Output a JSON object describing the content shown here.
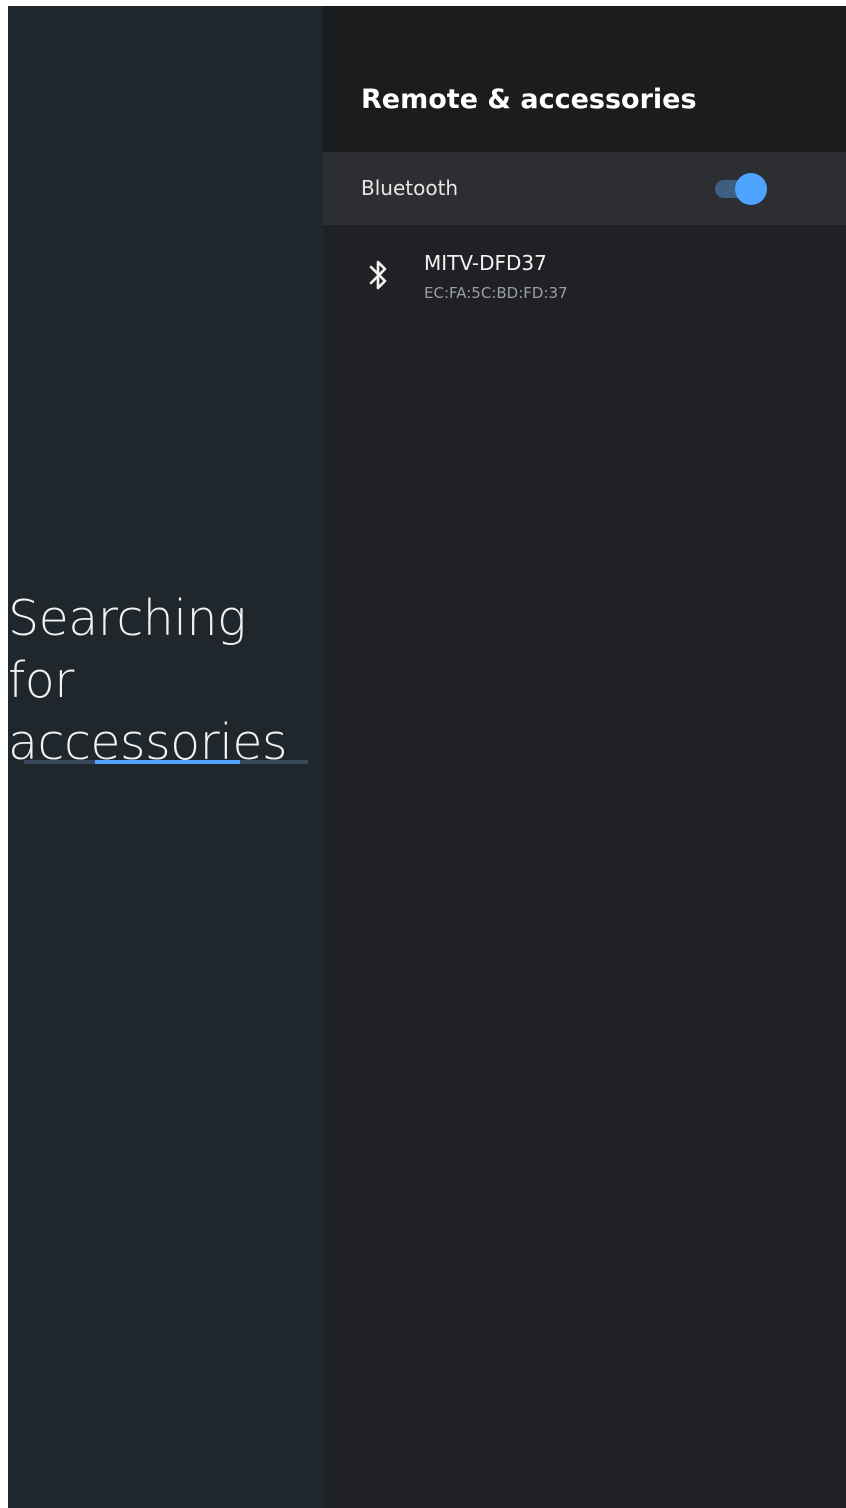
{
  "left_panel": {
    "title_line1": "Searching for",
    "title_line2": "accessories",
    "progress_start": 0.25,
    "progress_end": 0.76,
    "progress_color": "#4da3ff"
  },
  "header": {
    "title": "Remote & accessories"
  },
  "bluetooth": {
    "label": "Bluetooth",
    "enabled": true,
    "accent": "#4da3ff"
  },
  "devices": [
    {
      "icon": "bluetooth-icon",
      "name": "MITV-DFD37",
      "address": "EC:FA:5C:BD:FD:37"
    }
  ]
}
